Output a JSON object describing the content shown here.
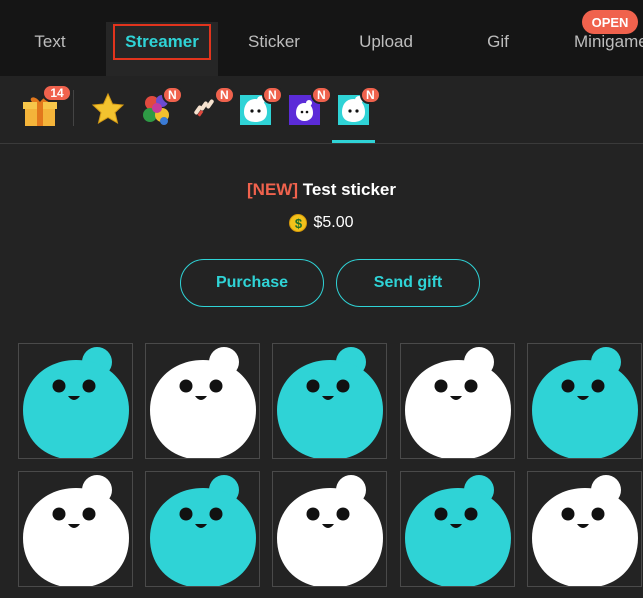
{
  "tabs": [
    {
      "label": "Text",
      "active": false
    },
    {
      "label": "Streamer",
      "active": true
    },
    {
      "label": "Sticker",
      "active": false
    },
    {
      "label": "Upload",
      "active": false
    },
    {
      "label": "Gif",
      "active": false
    },
    {
      "label": "Minigame",
      "active": false
    }
  ],
  "open_badge": "OPEN",
  "sub_tabs": [
    {
      "name": "gift-icon",
      "badge": "14"
    },
    {
      "name": "star-icon",
      "badge": ""
    },
    {
      "name": "flower-sticker-pack-icon",
      "badge": "N"
    },
    {
      "name": "hands-sticker-pack-icon",
      "badge": "N"
    },
    {
      "name": "blob-sticker-pack-icon",
      "badge": "N"
    },
    {
      "name": "purple-sticker-pack-icon",
      "badge": "N"
    },
    {
      "name": "blob-sticker-pack-selected-icon",
      "badge": "N"
    }
  ],
  "sticker": {
    "new_tag": "[NEW]",
    "name": "Test sticker",
    "coin_symbol": "$",
    "price": "$5.00"
  },
  "buttons": {
    "purchase": "Purchase",
    "send_gift": "Send gift"
  },
  "grid_colors": [
    "teal",
    "white",
    "teal",
    "white",
    "teal",
    "white",
    "teal",
    "white",
    "teal",
    "white"
  ],
  "colors": {
    "accent": "#2fd3d6",
    "badge": "#f0624d",
    "bg": "#232323"
  }
}
